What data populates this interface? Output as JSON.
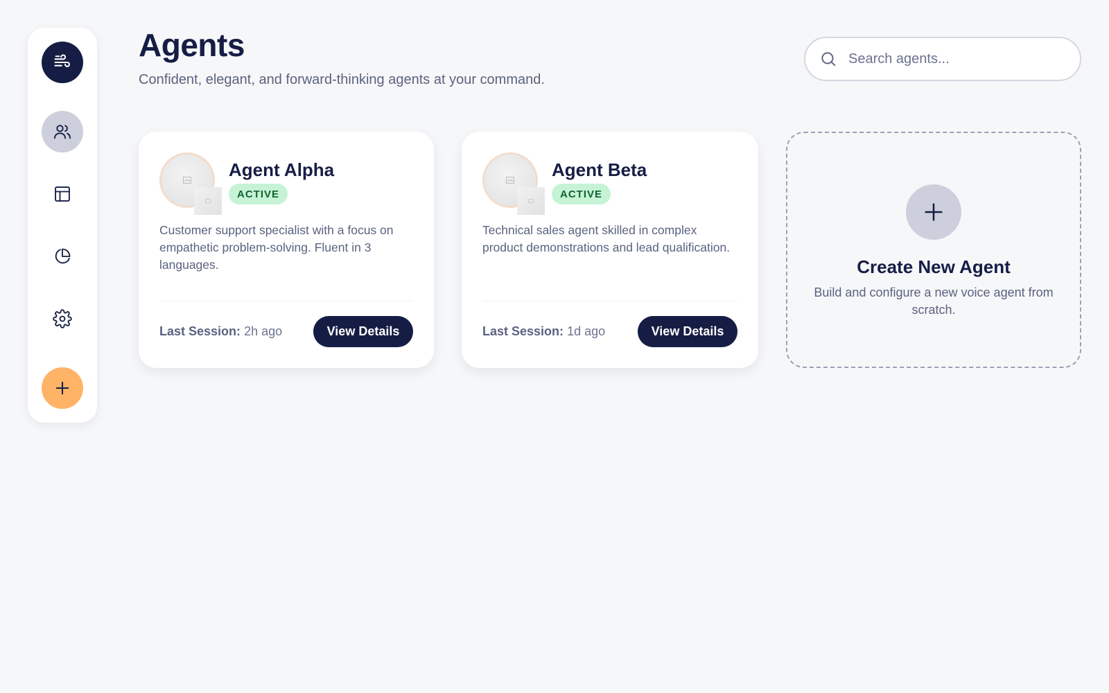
{
  "colors": {
    "primary": "#161d45",
    "accent": "#ffb366",
    "active_badge_bg": "#c6f3d6",
    "active_badge_text": "#11642e",
    "background": "#f6f7f9"
  },
  "sidebar": {
    "items": [
      {
        "name": "logo",
        "icon": "wind-icon",
        "active": true
      },
      {
        "name": "agents",
        "icon": "users-icon",
        "selected": true
      },
      {
        "name": "layout",
        "icon": "layout-icon"
      },
      {
        "name": "analytics",
        "icon": "pie-chart-icon"
      },
      {
        "name": "settings",
        "icon": "gear-icon"
      },
      {
        "name": "add",
        "icon": "plus-icon"
      }
    ]
  },
  "header": {
    "title": "Agents",
    "subtitle": "Confident, elegant, and forward-thinking agents at your command."
  },
  "search": {
    "placeholder": "Search agents...",
    "value": "",
    "icon": "search-icon"
  },
  "agents": [
    {
      "name": "Agent Alpha",
      "status": "ACTIVE",
      "description": "Customer support specialist with a focus on empathetic problem-solving. Fluent in 3 languages.",
      "last_session_label": "Last Session:",
      "last_session_value": "2h ago",
      "button_label": "View Details"
    },
    {
      "name": "Agent Beta",
      "status": "ACTIVE",
      "description": "Technical sales agent skilled in complex product demonstrations and lead qualification.",
      "last_session_label": "Last Session:",
      "last_session_value": "1d ago",
      "button_label": "View Details"
    }
  ],
  "create_card": {
    "title": "Create New Agent",
    "description": "Build and configure a new voice agent from scratch.",
    "icon": "plus-icon"
  }
}
